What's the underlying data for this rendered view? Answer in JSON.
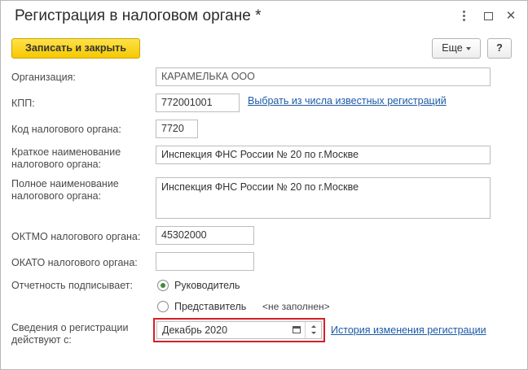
{
  "window": {
    "title": "Регистрация в налоговом органе *"
  },
  "toolbar": {
    "save_close_label": "Записать и закрыть",
    "more_label": "Еще",
    "help_label": "?"
  },
  "form": {
    "organization": {
      "label": "Организация:",
      "value": "КАРАМЕЛЬКА ООО"
    },
    "kpp": {
      "label": "КПП:",
      "value": "772001001",
      "link": "Выбрать из числа известных регистраций"
    },
    "tax_code": {
      "label": "Код налогового органа:",
      "value": "7720"
    },
    "short_name": {
      "label_line1": "Краткое наименование",
      "label_line2": "налогового органа:",
      "value": "Инспекция ФНС России № 20 по г.Москве"
    },
    "full_name": {
      "label_line1": "Полное наименование",
      "label_line2": "налогового органа:",
      "value": "Инспекция ФНС России № 20 по г.Москве"
    },
    "oktmo": {
      "label": "ОКТМО налогового органа:",
      "value": "45302000"
    },
    "okato": {
      "label": "ОКАТО налогового органа:",
      "value": ""
    },
    "signer": {
      "label": "Отчетность подписывает:",
      "option_head": "Руководитель",
      "option_rep": "Представитель",
      "rep_hint": "<не заполнен>",
      "selected": "Руководитель"
    },
    "registration_date": {
      "label_line1": "Сведения о регистрации",
      "label_line2": "действуют с:",
      "value": "Декабрь 2020",
      "history_link": "История изменения регистрации"
    }
  },
  "colors": {
    "primary_button": "#f5c800",
    "link": "#1c5aa6",
    "highlight_border": "#d61f26",
    "radio_selected": "#3e8b3e"
  },
  "icons": [
    "more-options-icon",
    "maximize-icon",
    "close-icon",
    "dropdown-caret-icon",
    "calendar-icon",
    "spin-up-icon",
    "spin-down-icon"
  ]
}
